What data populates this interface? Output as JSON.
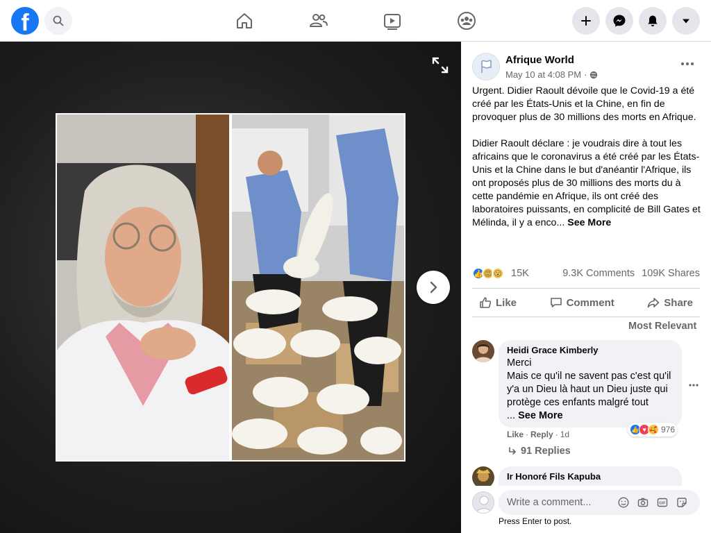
{
  "topbar": {
    "logo_letter": "f",
    "nav": [
      "home-icon",
      "friends-icon",
      "watch-icon",
      "groups-icon"
    ],
    "right_buttons": [
      "plus-icon",
      "messenger-icon",
      "notifications-icon",
      "account-menu-icon"
    ]
  },
  "post": {
    "page_name": "Afrique World",
    "timestamp": "May 10 at 4:08 PM",
    "separator": "·",
    "paragraph1": "Urgent. Didier Raoult dévoile que le Covid-19 a été créé par les États-Unis et la Chine, en fin de provoquer plus de 30 millions des morts en Afrique.",
    "paragraph2": "Didier Raoult déclare : je voudrais dire à tout les africains que le coronavirus a été créé par les États-Unis et la Chine dans le but d'anéantir l'Afrique, ils ont proposés plus de 30 millions des morts du à cette pandémie en Afrique, ils ont créé des laboratoires puissants, en complicité de Bill Gates et Mélinda, il y a enco...",
    "see_more": "See More",
    "reaction_count": "15K",
    "comments_count": "9.3K Comments",
    "shares_count": "109K Shares"
  },
  "actions": {
    "like": "Like",
    "comment": "Comment",
    "share": "Share"
  },
  "comments": {
    "sort_label": "Most Relevant",
    "items": [
      {
        "author": "Heidi Grace Kimberly",
        "line1": "Merci",
        "line2": "Mais ce qu'il ne savent pas c'est qu'il y'a un Dieu là haut un Dieu juste qui protège ces enfants malgré tout",
        "ellipsis": "...",
        "see_more": "See More",
        "reactions": "976",
        "like": "Like",
        "dot": "·",
        "reply": "Reply",
        "age": "1d",
        "replies": "91 Replies"
      },
      {
        "author": "Ir Honoré Fils Kapuba"
      }
    ]
  },
  "composer": {
    "placeholder": "Write a comment...",
    "hint": "Press Enter to post."
  },
  "colors": {
    "brand": "#1877f2",
    "text_secondary": "#65676b",
    "surface": "#f0f2f5"
  }
}
